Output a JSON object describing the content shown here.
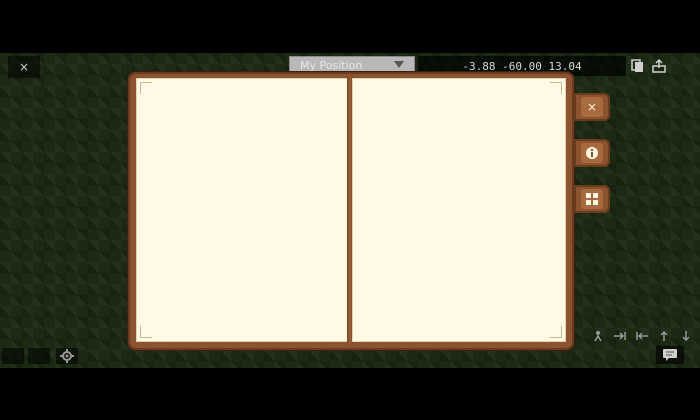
{
  "hud": {
    "close_label": "×",
    "position_dropdown": "My Position",
    "coords": "-3.88 -60.00 13.04"
  },
  "book_side_buttons": {
    "close_label": "×",
    "info_label": "i"
  },
  "icons": {
    "top_right": [
      "copy-icon",
      "export-icon"
    ],
    "bottom_right": [
      "sneak-icon",
      "fly-right-icon",
      "fly-left-icon",
      "up-arrow-icon",
      "down-arrow-icon"
    ],
    "bottom_left": [
      "blank-icon",
      "blank-icon",
      "gear-icon"
    ],
    "chat": "chat-icon"
  },
  "colors": {
    "book_frame": "#8b5330",
    "page": "#fff9e6",
    "grass": "#1c2a14"
  }
}
